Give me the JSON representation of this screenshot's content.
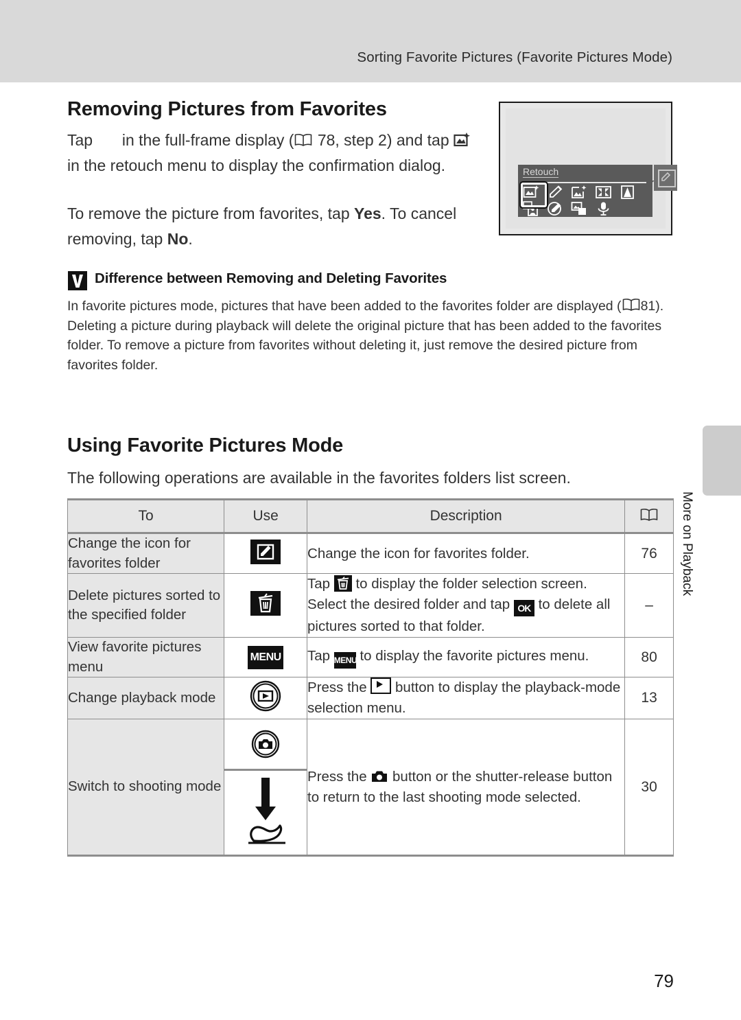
{
  "header": {
    "running_title": "Sorting Favorite Pictures (Favorite Pictures Mode)"
  },
  "sections": {
    "removing": {
      "title": "Removing Pictures from Favorites",
      "para1_a": "Tap",
      "para1_b": "in the full-frame display (",
      "para1_page": "78, step 2) and",
      "para1_c": "tap",
      "para1_d": "in the retouch menu to display the confirmation dialog.",
      "para2_a": "To remove the picture from favorites, tap ",
      "para2_yes": "Yes",
      "para2_b": ". To cancel removing, tap ",
      "para2_no": "No",
      "para2_c": "."
    },
    "note": {
      "heading": "Difference between Removing and Deleting Favorites",
      "body_a": "In favorite pictures mode, pictures that have been added to the favorites folder are displayed (",
      "body_page": "81",
      "body_b": "). Deleting a picture during playback will delete the original picture that has been added to the favorites folder. To remove a picture from favorites without deleting it, just remove the desired picture from favorites folder."
    },
    "using": {
      "title": "Using Favorite Pictures Mode",
      "intro": "The following operations are available in the favorites folders list screen."
    }
  },
  "camera_screen": {
    "menu_label": "Retouch",
    "icons_row1": [
      "copy-selected-icon",
      "pencil-icon",
      "quick-retouch-icon",
      "d-lighting-icon",
      "contrast-icon"
    ],
    "icons_row2": [
      "skin-softening-icon",
      "paint-icon",
      "small-picture-icon",
      "voice-memo-icon"
    ],
    "tab_icon": "retouch-tab-icon"
  },
  "thumb_tab": {
    "label": "More on Playback"
  },
  "table": {
    "headers": {
      "to": "To",
      "use": "Use",
      "description": "Description",
      "reference": "book-icon"
    },
    "rows": [
      {
        "to": "Change the icon for favorites folder",
        "use_icon": "edit-icon",
        "description": "Change the icon for favorites folder.",
        "reference": "76"
      },
      {
        "to": "Delete pictures sorted to the specified folder",
        "use_icon": "trash-icon",
        "desc_a": "Tap",
        "desc_b": "to display the folder selection screen. Select the desired folder and tap",
        "desc_c": "to delete all pictures sorted to that folder.",
        "reference": "–"
      },
      {
        "to": "View favorite pictures menu",
        "use_icon": "menu-icon",
        "desc_a": "Tap",
        "desc_b": "to display the favorite pictures menu.",
        "reference": "80"
      },
      {
        "to": "Change playback mode",
        "use_icon": "playback-button-icon",
        "desc_a": "Press the",
        "desc_b": "button to display the playback-mode selection menu.",
        "reference": "13"
      },
      {
        "to": "Switch to shooting mode",
        "use_icon_top": "camera-button-icon",
        "use_icon_bottom": "shutter-release-icon",
        "desc_a": "Press the",
        "desc_b": "button or the shutter-release button to return to the last shooting mode selected.",
        "reference": "30"
      }
    ]
  },
  "footer": {
    "page_number": "79"
  },
  "colors": {
    "header_band": "#d9d9d9",
    "table_header_bg": "#e6e6e6",
    "table_rule": "#8d8d8d",
    "camera_menu_bg": "#5a5a5a",
    "thumb_tab": "#cccccc"
  }
}
